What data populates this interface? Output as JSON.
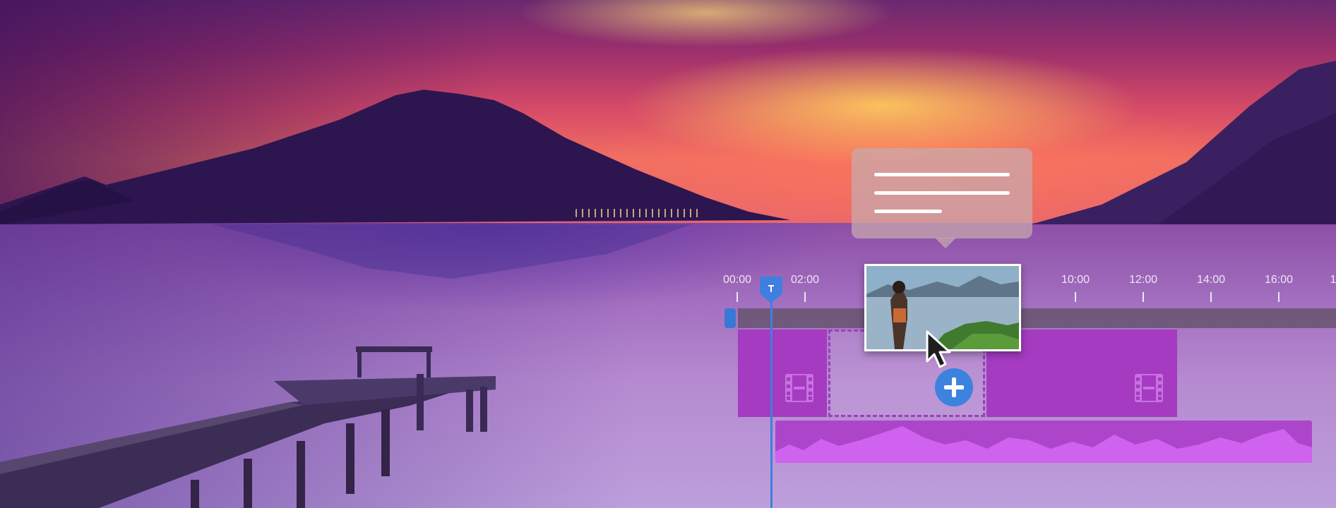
{
  "timeline": {
    "ruler_labels": [
      "00:00",
      "02:00",
      "10:00",
      "12:00",
      "14:00",
      "16:00",
      "1"
    ],
    "playhead_time": "00:00"
  },
  "icons": {
    "tooltip": "text-lines-icon",
    "clip": "film-strip-icon",
    "cursor": "pointer-cursor-icon",
    "add": "plus-icon"
  },
  "colors": {
    "accent_blue": "#3f7fe0",
    "clip_purple": "#a43bc0",
    "audio_purple": "#ad45cb",
    "waveform": "#cf62ee"
  }
}
